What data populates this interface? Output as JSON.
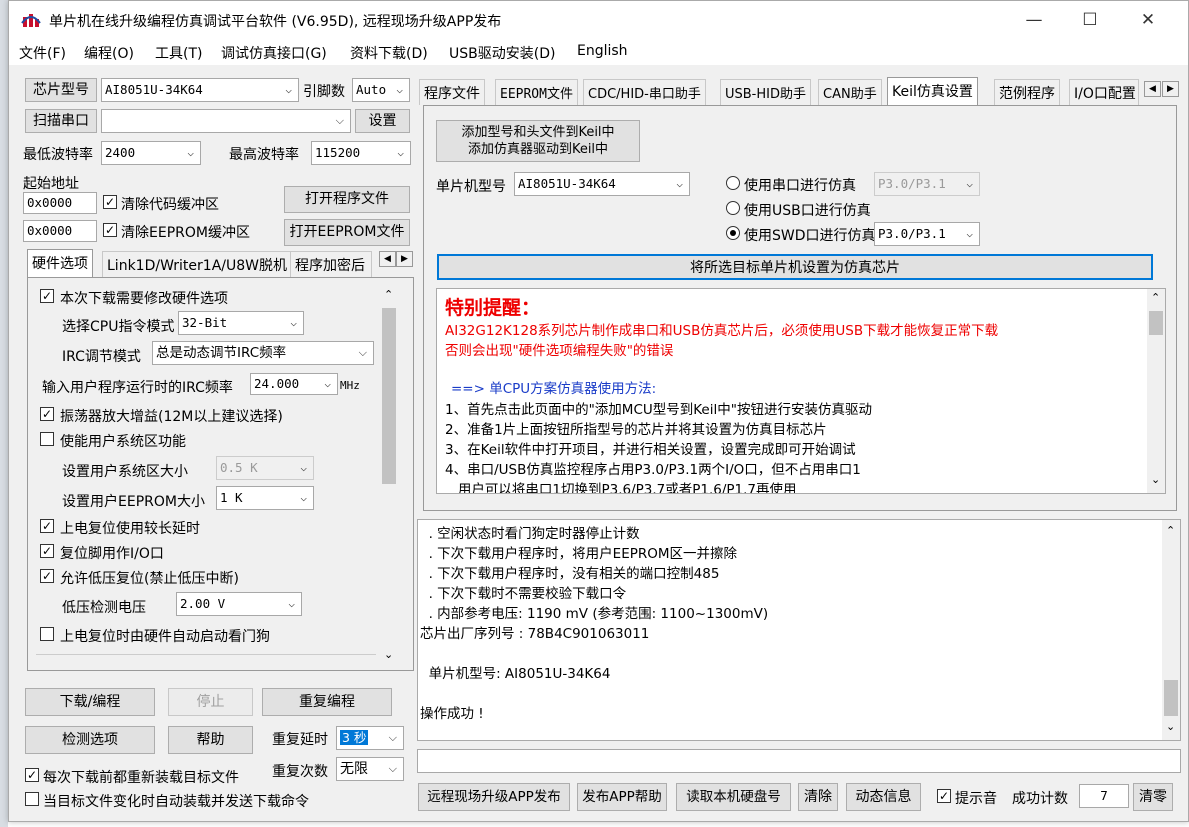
{
  "window": {
    "title": "单片机在线升级编程仿真调试平台软件 (V6.95D), 远程现场升级APP发布",
    "minimize": "—",
    "maximize": "☐",
    "close": "✕"
  },
  "menu": [
    "文件(F)",
    "编程(O)",
    "工具(T)",
    "调试仿真接口(G)",
    "资料下载(D)",
    "USB驱动安装(D)",
    "English"
  ],
  "left": {
    "chip_model_btn": "芯片型号",
    "chip_model": "AI8051U-34K64",
    "pin_label": "引脚数",
    "pin_value": "Auto",
    "scan_btn": "扫描串口",
    "port_value": "",
    "settings_btn": "设置",
    "min_baud_label": "最低波特率",
    "min_baud": "2400",
    "max_baud_label": "最高波特率",
    "max_baud": "115200",
    "start_addr_label": "起始地址",
    "code_addr": "0x0000",
    "clear_code": "清除代码缓冲区",
    "open_prog_btn": "打开程序文件",
    "eeprom_addr": "0x0000",
    "clear_eeprom": "清除EEPROM缓冲区",
    "open_eeprom_btn": "打开EEPROM文件",
    "subtabs": [
      "硬件选项",
      "Link1D/Writer1A/U8W脱机",
      "程序加密后"
    ],
    "hw": {
      "modify": "本次下载需要修改硬件选项",
      "cpu_mode_label": "选择CPU指令模式",
      "cpu_mode": "32-Bit",
      "irc_mode_label": "IRC调节模式",
      "irc_mode": "总是动态调节IRC频率",
      "irc_freq_label": "输入用户程序运行时的IRC频率",
      "irc_freq": "24.000",
      "irc_unit": "MHz",
      "osc_gain": "振荡器放大增益(12M以上建议选择)",
      "user_sys": "使能用户系统区功能",
      "user_sys_size_label": "设置用户系统区大小",
      "user_sys_size": "0.5 K",
      "user_eeprom_label": "设置用户EEPROM大小",
      "user_eeprom": "1   K",
      "long_delay": "上电复位使用较长延时",
      "reset_io": "复位脚用作I/O口",
      "lvd_reset": "允许低压复位(禁止低压中断)",
      "lvd_label": "低压检测电压",
      "lvd_value": "2.00 V",
      "wdt_auto": "上电复位时由硬件自动启动看门狗"
    },
    "download_btn": "下载/编程",
    "stop_btn": "停止",
    "repeat_btn": "重复编程",
    "check_btn": "检测选项",
    "help_btn": "帮助",
    "repeat_delay_label": "重复延时",
    "repeat_delay": "3 秒",
    "reload_each": "每次下载前都重新装载目标文件",
    "repeat_count_label": "重复次数",
    "repeat_count": "无限",
    "auto_send": "当目标文件变化时自动装载并发送下载命令"
  },
  "right": {
    "tabs": [
      "程序文件",
      "EEPROM文件",
      "CDC/HID-串口助手",
      "USB-HID助手",
      "CAN助手",
      "Keil仿真设置",
      "范例程序",
      "I/O口配置"
    ],
    "keil": {
      "add_btn_line1": "添加型号和头文件到Keil中",
      "add_btn_line2": "添加仿真器驱动到Keil中",
      "mcu_label": "单片机型号",
      "mcu_value": "AI8051U-34K64",
      "opt_serial": "使用串口进行仿真",
      "opt_serial_port": "P3.0/P3.1",
      "opt_usb": "使用USB口进行仿真",
      "opt_swd": "使用SWD口进行仿真",
      "opt_swd_port": "P3.0/P3.1",
      "set_target_btn": "将所选目标单片机设置为仿真芯片",
      "notice_title": "特别提醒：",
      "notice_line1": "AI32G12K128系列芯片制作成串口和USB仿真芯片后，必须使用USB下载才能恢复正常下载",
      "notice_line2": "否则会出现\"硬件选项编程失败\"的错误",
      "method_title": "==> 单CPU方案仿真器使用方法:",
      "steps": [
        "1、首先点击此页面中的\"添加MCU型号到Keil中\"按钮进行安装仿真驱动",
        "2、准备1片上面按钮所指型号的芯片并将其设置为仿真目标芯片",
        "3、在Keil软件中打开项目，并进行相关设置，设置完成即可开始调试",
        "4、串口/USB仿真监控程序占用P3.0/P3.1两个I/O口，但不占用串口1",
        "   用户可以将串口1切换到P3.6/P3.7或者P1.6/P1.7再使用"
      ]
    },
    "log": [
      "  . 空闲状态时看门狗定时器停止计数",
      "  . 下次下载用户程序时，将用户EEPROM区一并擦除",
      "  . 下次下载用户程序时，没有相关的端口控制485",
      "  . 下次下载时不需要校验下载口令",
      "  . 内部参考电压: 1190 mV (参考范围: 1100~1300mV)",
      "芯片出厂序列号 : 78B4C901063011",
      "",
      "  单片机型号: AI8051U-34K64",
      "",
      "操作成功 !"
    ],
    "bottom": {
      "publish_btn": "远程现场升级APP发布",
      "publish_help_btn": "发布APP帮助",
      "read_disk_btn": "读取本机硬盘号",
      "clear_btn": "清除",
      "dyn_info_btn": "动态信息",
      "beep_label": "提示音",
      "count_label": "成功计数",
      "count_value": "7",
      "reset_count_btn": "清零"
    }
  }
}
